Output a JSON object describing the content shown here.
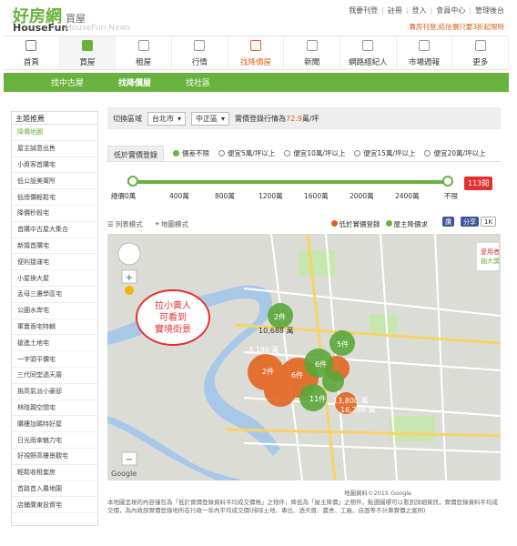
{
  "logo": {
    "cn": "好房網",
    "en": "HouseFun",
    "sub": "買屋",
    "sub2": "HouseFun News"
  },
  "toplinks": [
    "我要刊登",
    "註冊",
    "登入",
    "會員中心",
    "管理後台"
  ],
  "slogan": "賣房刊登,結信價只要3折起限時",
  "nav": [
    {
      "label": "首頁"
    },
    {
      "label": "買屋"
    },
    {
      "label": "租屋"
    },
    {
      "label": "行情"
    },
    {
      "label": "找降價屋"
    },
    {
      "label": "新聞"
    },
    {
      "label": "網路經紀人"
    },
    {
      "label": "市場週報"
    },
    {
      "label": "更多"
    }
  ],
  "subnav": [
    "找中古屋",
    "找降價屋",
    "找社區"
  ],
  "sidebar": {
    "head": "主題推薦",
    "items": [
      "降價地圖",
      "屋主誠意出售",
      "小資客首購宅",
      "低公設美寓所",
      "低總價輕鬆宅",
      "降價秒殺宅",
      "首購中古屋大集合",
      "新婚首購宅",
      "便利捷運宅",
      "小屋換大屋",
      "孟母三遷學區宅",
      "公園水岸宅",
      "軍賣香宅特輯",
      "搶進土地宅",
      "一字頭平價宅",
      "三代同堂透天厝",
      "挑高氣派小豪邸",
      "林陰親空間宅",
      "購樓加碼特好屋",
      "日光雨傘魅力宅",
      "好視野高樓景觀宅",
      "輕鬆收租套房",
      "首路首入農地園",
      "店鋪廣東投資宅"
    ]
  },
  "filter": {
    "label": "切換區域",
    "city": "台北市",
    "district": "中正區",
    "price_prefix": "實價登錄行情為",
    "price_value": "72.9",
    "price_unit": "萬/坪"
  },
  "tab_low": "低於實價登錄",
  "radios": [
    "價差不限",
    "便宜5萬/坪以上",
    "便宜10萬/坪以上",
    "便宜15萬/坪以上",
    "便宜20萬/坪以上"
  ],
  "count": "113間",
  "ticks": [
    "總價0萬",
    "400萬",
    "800萬",
    "1200萬",
    "1600萬",
    "2000萬",
    "2400萬",
    "不限"
  ],
  "view": {
    "list": "列表模式",
    "map": "地圖模式"
  },
  "legend": [
    "低於實價登錄",
    "屋主降價求"
  ],
  "map": {
    "bubble": "拉小黃人\n可看到\n實境街景",
    "labels": [
      "2件",
      "10,688 萬",
      "3,180 萬",
      "2件",
      "6件",
      "6件",
      "5件",
      "11件",
      "13,800 萬",
      "16,288 萬"
    ],
    "badge": "徽\n愛用者\n抽大獎"
  },
  "credit": "地圖資料©2015 Google",
  "footnote": "本地圖呈現的內容僅包為「低於實價登錄資料平均成交價格」之物件，降低為「屋主降價」之物件，點選圖標可以看到詳細資訊，實價登錄資料平均成交價，為內政部實價登錄地所在行政一年內平均成交價(排除土地、車位、透天厝、農舍、工廠、店面等不計算實價之案例)",
  "colors": {
    "green": "#6ab23e",
    "orange": "#e2621b",
    "red": "#e53030"
  }
}
